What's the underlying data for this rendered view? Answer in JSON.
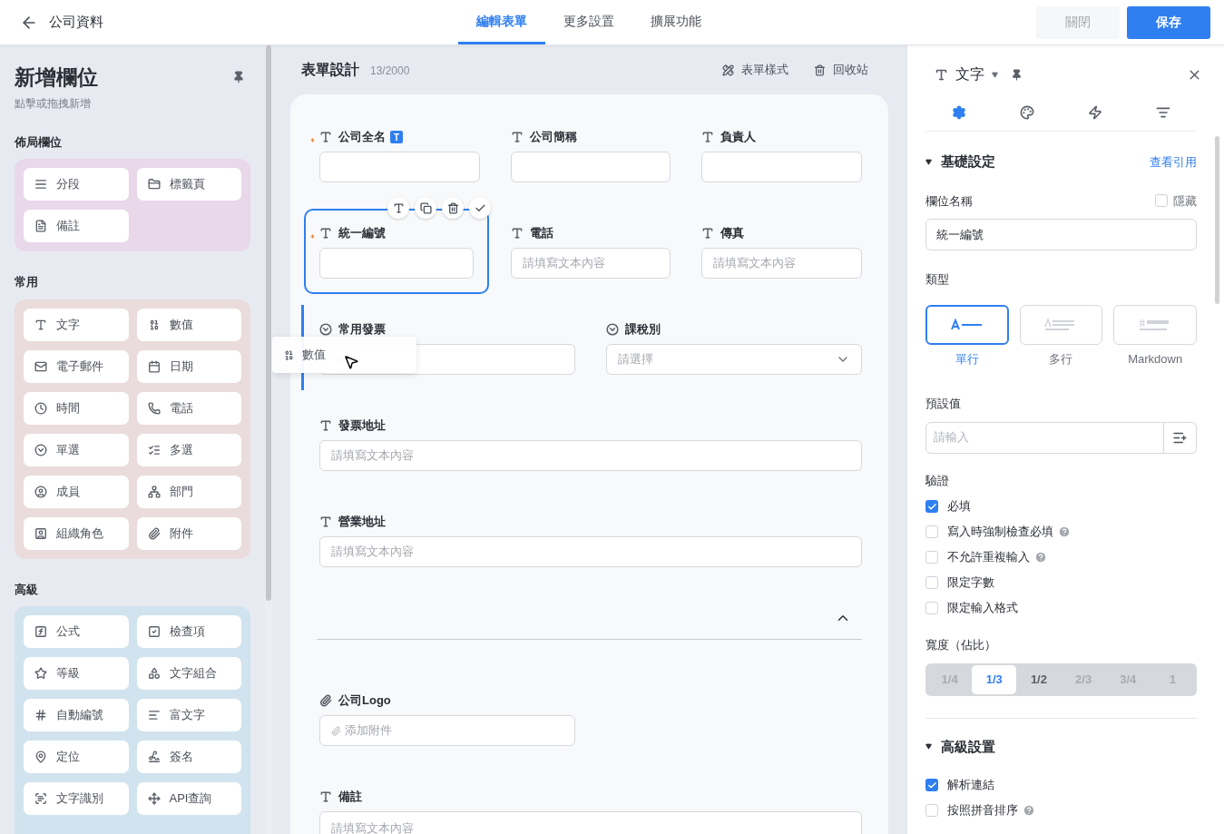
{
  "header": {
    "title": "公司資料",
    "tabs": [
      {
        "label": "編輯表單",
        "selected": true
      },
      {
        "label": "更多設置",
        "selected": false
      },
      {
        "label": "擴展功能",
        "selected": false
      }
    ],
    "buttons": [
      {
        "label": "關閉",
        "kind": "secondary",
        "disabled": true
      },
      {
        "label": "保存",
        "kind": "primary",
        "disabled": false
      }
    ]
  },
  "sidebar": {
    "title": "新增欄位",
    "subtitle": "點擊或拖拽新增",
    "groups": [
      {
        "title": "佈局欄位",
        "color": "#e8d8ea",
        "items": [
          "分段",
          "標籤頁",
          "備註"
        ]
      },
      {
        "title": "常用",
        "color": "#eadcdc",
        "items": [
          "文字",
          "數值",
          "電子郵件",
          "日期",
          "時間",
          "電話",
          "單選",
          "多選",
          "成員",
          "部門",
          "組織角色",
          "附件"
        ]
      },
      {
        "title": "高級",
        "color": "#d1e3ee",
        "items": [
          "公式",
          "檢查項",
          "等級",
          "文字組合",
          "自動編號",
          "富文字",
          "定位",
          "簽名",
          "文字識別",
          "API查詢"
        ]
      }
    ]
  },
  "canvas": {
    "title": "表單設計",
    "count": "13/2000",
    "actions": [
      {
        "label": "表單樣式",
        "kind": "style"
      },
      {
        "label": "回收站",
        "kind": "trash"
      }
    ],
    "rows": [
      {
        "kind": "grid",
        "drop_target": false,
        "fields": [
          {
            "kind": "text",
            "label": "公司全名",
            "required": true,
            "badge": "T",
            "selected": false
          },
          {
            "kind": "text",
            "label": "公司簡稱",
            "required": false,
            "selected": false
          },
          {
            "kind": "text",
            "label": "負責人",
            "required": false,
            "selected": false
          }
        ]
      },
      {
        "kind": "grid",
        "drop_target": false,
        "fields": [
          {
            "kind": "text",
            "label": "統一編號",
            "required": true,
            "selected": true
          },
          {
            "kind": "text",
            "label": "電話",
            "required": false,
            "selected": false,
            "placeholder": "請填寫文本內容"
          },
          {
            "kind": "text",
            "label": "傳真",
            "required": false,
            "selected": false,
            "placeholder": "請填寫文本內容"
          }
        ]
      },
      {
        "kind": "grid",
        "drop_target": true,
        "fields": [
          {
            "kind": "select",
            "label": "常用發票",
            "required": false,
            "selected": false
          },
          {
            "kind": "select",
            "label": "課稅別",
            "required": false,
            "selected": false,
            "placeholder": "請選擇"
          }
        ]
      },
      {
        "kind": "grid",
        "drop_target": false,
        "fields": [
          {
            "kind": "text",
            "label": "發票地址",
            "required": false,
            "selected": false,
            "placeholder": "請填寫文本內容"
          }
        ]
      },
      {
        "kind": "grid",
        "drop_target": false,
        "fields": [
          {
            "kind": "text",
            "label": "營業地址",
            "required": false,
            "selected": false,
            "placeholder": "請填寫文本內容"
          }
        ]
      },
      {
        "kind": "divider",
        "expanded": true
      },
      {
        "kind": "grid",
        "drop_target": false,
        "fields": [
          {
            "kind": "attachment",
            "label": "公司Logo",
            "required": false,
            "selected": false,
            "placeholder": "添加附件"
          }
        ]
      },
      {
        "kind": "grid",
        "drop_target": false,
        "fields": [
          {
            "kind": "textarea",
            "label": "備註",
            "required": false,
            "selected": false,
            "placeholder": "請填寫文本內容"
          }
        ]
      }
    ]
  },
  "drag_ghost": {
    "label": "數值"
  },
  "properties": {
    "field_type": "文字",
    "tabs": [
      {
        "kind": "settings",
        "selected": true
      },
      {
        "kind": "style",
        "selected": false
      },
      {
        "kind": "actions",
        "selected": false
      },
      {
        "kind": "sort",
        "selected": false
      }
    ],
    "basic": {
      "title": "基礎設定",
      "expanded": true,
      "link": "查看引用",
      "name_label": "欄位名稱",
      "hidden_label": "隱藏",
      "hidden": false,
      "name_value": "統一編號",
      "type_label": "類型",
      "types": [
        {
          "label": "單行",
          "kind": "single",
          "selected": true
        },
        {
          "label": "多行",
          "kind": "multi",
          "selected": false
        },
        {
          "label": "Markdown",
          "kind": "markdown",
          "selected": false
        }
      ],
      "default_label": "預設值",
      "default_placeholder": "請輸入",
      "validation_label": "驗證",
      "validations": [
        {
          "label": "必填",
          "checked": true,
          "help": false
        },
        {
          "label": "寫入時強制檢查必填",
          "checked": false,
          "help": true
        },
        {
          "label": "不允許重複輸入",
          "checked": false,
          "help": true
        },
        {
          "label": "限定字數",
          "checked": false,
          "help": false
        },
        {
          "label": "限定輸入格式",
          "checked": false,
          "help": false
        }
      ],
      "width_label": "寬度（佔比）",
      "widths": [
        {
          "label": "1/4",
          "selected": false,
          "disabled": true
        },
        {
          "label": "1/3",
          "selected": true,
          "disabled": false
        },
        {
          "label": "1/2",
          "selected": false,
          "disabled": false
        },
        {
          "label": "2/3",
          "selected": false,
          "disabled": true
        },
        {
          "label": "3/4",
          "selected": false,
          "disabled": true
        },
        {
          "label": "1",
          "selected": false,
          "disabled": true
        }
      ]
    },
    "advanced": {
      "title": "高級設置",
      "expanded": true,
      "options": [
        {
          "label": "解析連結",
          "checked": true,
          "help": false
        },
        {
          "label": "按照拼音排序",
          "checked": false,
          "help": true
        }
      ]
    }
  }
}
